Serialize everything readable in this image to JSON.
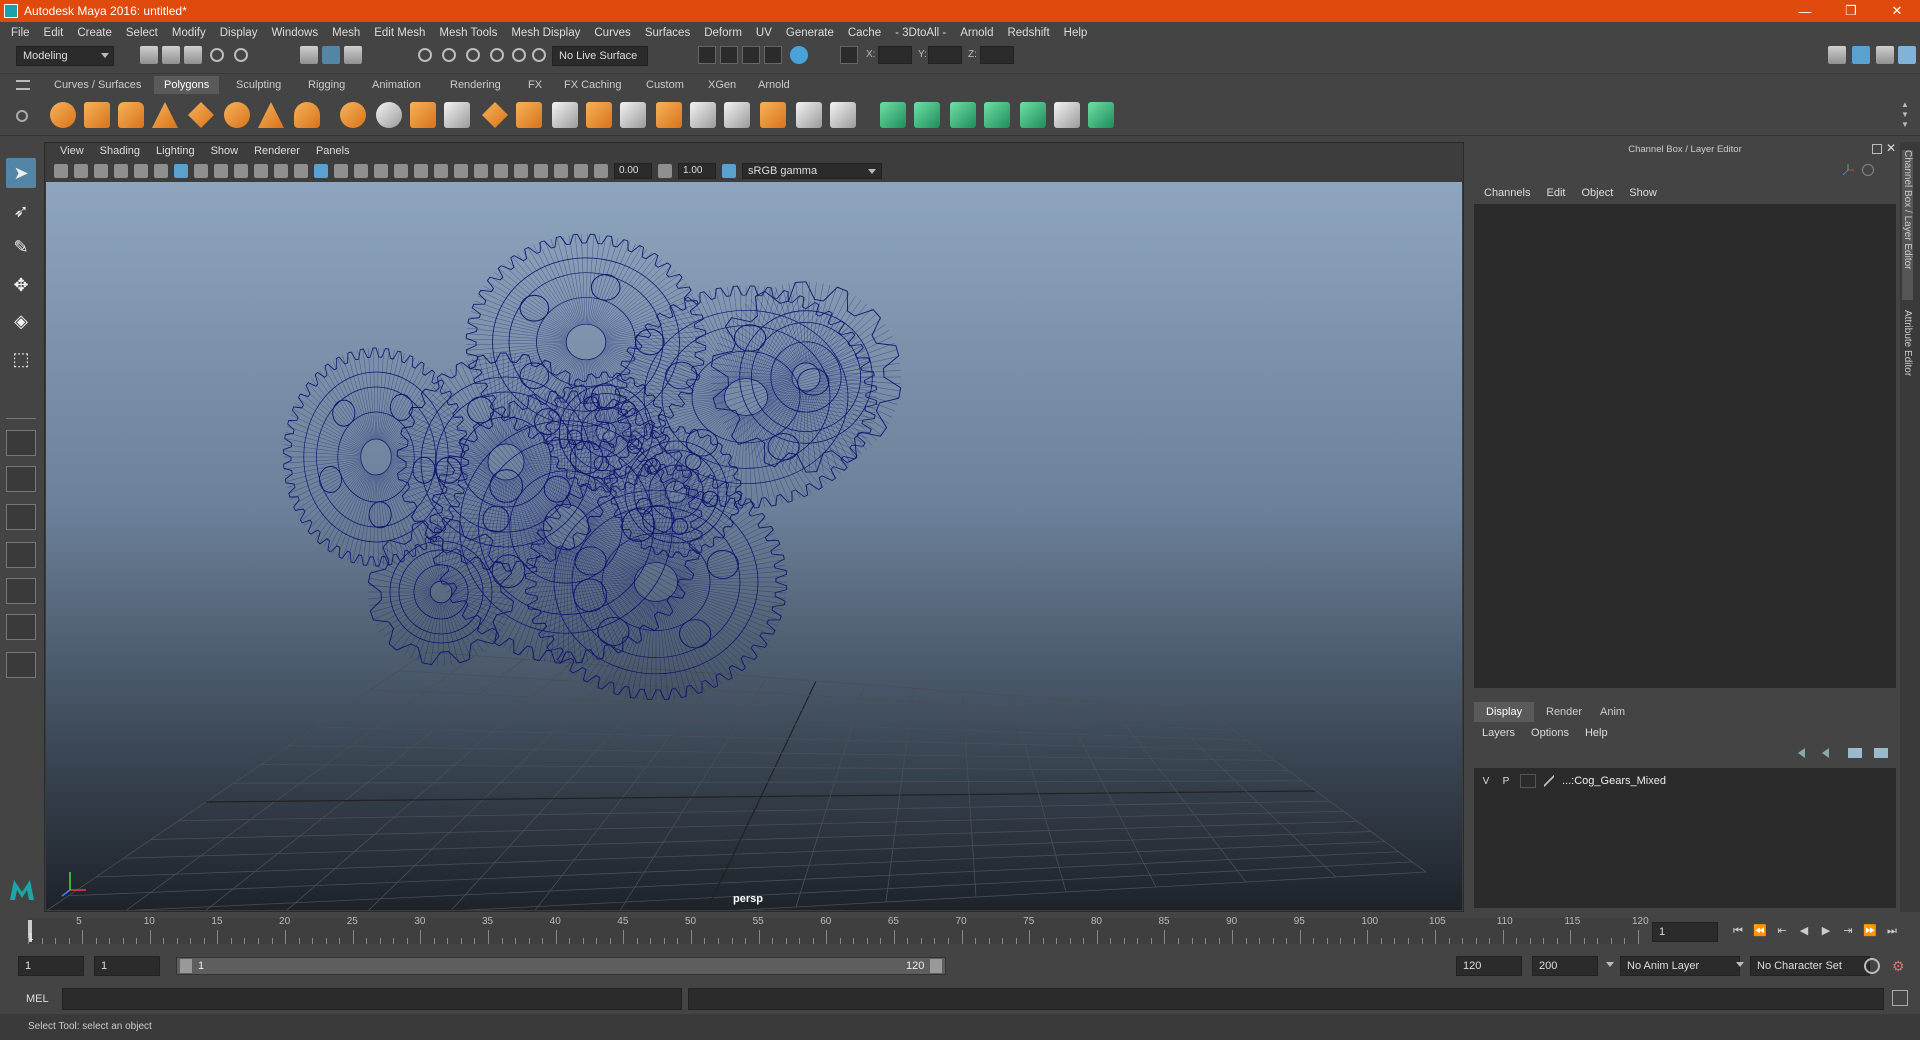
{
  "window": {
    "title": "Autodesk Maya 2016: untitled*",
    "controls": [
      "—",
      "❐",
      "✕"
    ]
  },
  "menubar": [
    "File",
    "Edit",
    "Create",
    "Select",
    "Modify",
    "Display",
    "Windows",
    "Mesh",
    "Edit Mesh",
    "Mesh Tools",
    "Mesh Display",
    "Curves",
    "Surfaces",
    "Deform",
    "UV",
    "Generate",
    "Cache",
    "- 3DtoAll -",
    "Arnold",
    "Redshift",
    "Help"
  ],
  "statusline": {
    "mode": "Modeling",
    "live_surface": "No Live Surface",
    "x_label": "X:",
    "y_label": "Y:",
    "z_label": "Z:"
  },
  "shelf_tabs": [
    "Curves / Surfaces",
    "Polygons",
    "Sculpting",
    "Rigging",
    "Animation",
    "Rendering",
    "FX",
    "FX Caching",
    "Custom",
    "XGen",
    "Arnold"
  ],
  "shelf_active": "Polygons",
  "viewport": {
    "menu": [
      "View",
      "Shading",
      "Lighting",
      "Show",
      "Renderer",
      "Panels"
    ],
    "exposure": "0.00",
    "gamma": "1.00",
    "color_space": "sRGB gamma",
    "camera_label": "persp"
  },
  "channel_box": {
    "title": "Channel Box / Layer Editor",
    "menu": [
      "Channels",
      "Edit",
      "Object",
      "Show"
    ]
  },
  "layer_editor": {
    "tabs": [
      "Display",
      "Render",
      "Anim"
    ],
    "active_tab": "Display",
    "menu": [
      "Layers",
      "Options",
      "Help"
    ],
    "layers": [
      {
        "v": "V",
        "p": "P",
        "name": "...:Cog_Gears_Mixed"
      }
    ]
  },
  "side_tabs": [
    "Channel Box / Layer Editor",
    "Attribute Editor"
  ],
  "timeline": {
    "labels": [
      "5",
      "10",
      "15",
      "20",
      "25",
      "30",
      "35",
      "40",
      "45",
      "50",
      "55",
      "60",
      "65",
      "70",
      "75",
      "80",
      "85",
      "90",
      "95",
      "100",
      "105",
      "110",
      "115",
      "120"
    ],
    "current_frame_marker": "1",
    "current_frame_field": "1"
  },
  "range": {
    "start": "1",
    "playback_start": "1",
    "slider_start": "1",
    "slider_end": "120",
    "playback_end": "120",
    "end": "200",
    "anim_layer": "No Anim Layer",
    "character_set": "No Character Set"
  },
  "command_line": {
    "label": "MEL"
  },
  "help_line": "Select Tool: select an object",
  "colors": {
    "titlebar": "#e04a0c",
    "wireframe": "#101470",
    "selection": "#5285a6"
  }
}
